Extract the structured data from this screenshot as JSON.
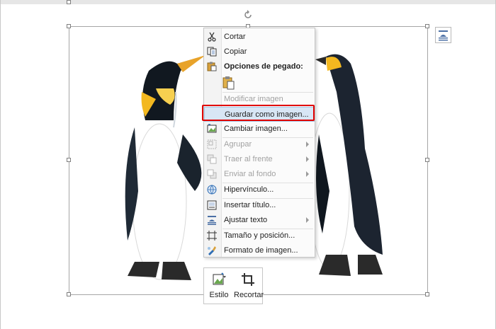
{
  "context_menu": {
    "items": [
      {
        "label": "Cortar",
        "enabled": true,
        "icon": "scissors-icon"
      },
      {
        "label": "Copiar",
        "enabled": true,
        "icon": "copy-icon"
      },
      {
        "label": "Opciones de pegado:",
        "enabled": true,
        "icon": "paste-icon",
        "header": true
      },
      {
        "label": "Modificar imagen",
        "enabled": false
      },
      {
        "label": "Guardar como imagen...",
        "enabled": true,
        "highlighted": true
      },
      {
        "label": "Cambiar imagen...",
        "enabled": true,
        "icon": "change-picture-icon"
      },
      {
        "label": "Agrupar",
        "enabled": false,
        "icon": "group-icon",
        "submenu": true
      },
      {
        "label": "Traer al frente",
        "enabled": false,
        "icon": "bring-front-icon",
        "submenu": true
      },
      {
        "label": "Enviar al fondo",
        "enabled": false,
        "icon": "send-back-icon",
        "submenu": true
      },
      {
        "label": "Hipervínculo...",
        "enabled": true,
        "icon": "hyperlink-icon"
      },
      {
        "label": "Insertar título...",
        "enabled": true,
        "icon": "caption-icon"
      },
      {
        "label": "Ajustar texto",
        "enabled": true,
        "icon": "wrap-text-icon",
        "submenu": true
      },
      {
        "label": "Tamaño y posición...",
        "enabled": true,
        "icon": "size-position-icon"
      },
      {
        "label": "Formato de imagen...",
        "enabled": true,
        "icon": "format-picture-icon"
      }
    ]
  },
  "mini_toolbar": {
    "style_label": "Estilo",
    "crop_label": "Recortar"
  },
  "colors": {
    "highlight_outline": "#e00000",
    "hover_fill": "#d8e6f5",
    "disabled_text": "#a2a2a2"
  }
}
